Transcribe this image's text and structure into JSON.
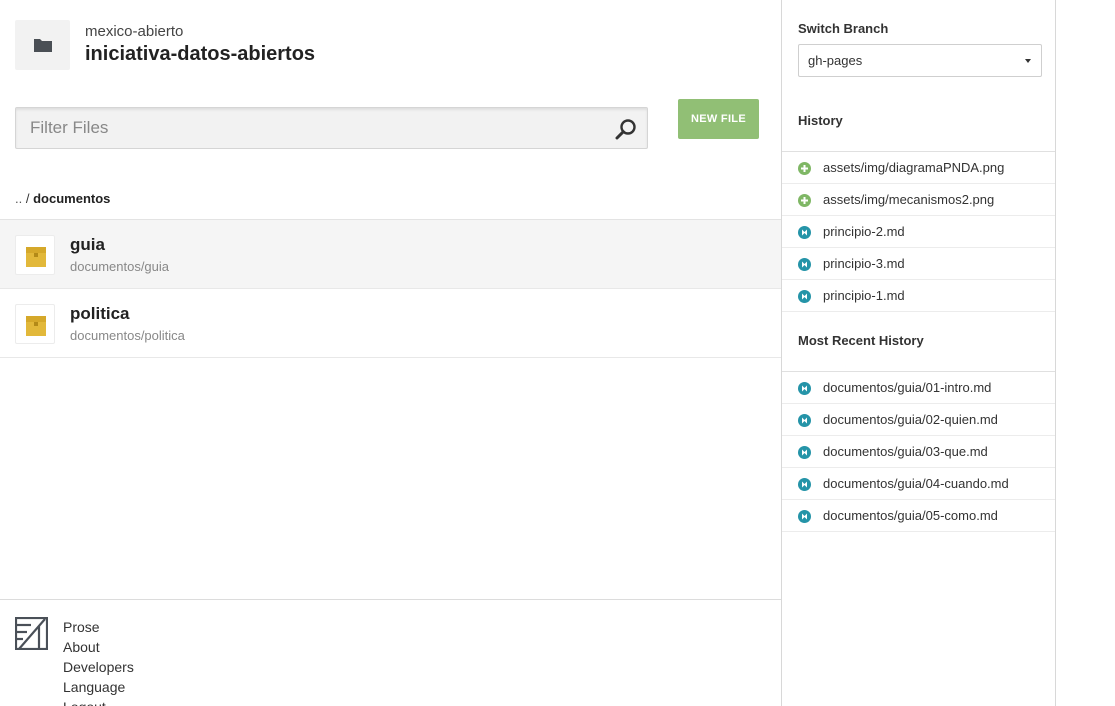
{
  "repo": {
    "owner": "mexico-abierto",
    "name": "iniciativa-datos-abiertos"
  },
  "filter": {
    "placeholder": "Filter Files",
    "value": ""
  },
  "toolbar": {
    "new_file_label": "NEW FILE"
  },
  "breadcrumb": {
    "up": "..",
    "separator": "/",
    "current": "documentos"
  },
  "files": [
    {
      "title": "guia",
      "path": "documentos/guia",
      "icon": "folder-icon"
    },
    {
      "title": "politica",
      "path": "documentos/politica",
      "icon": "folder-icon"
    }
  ],
  "footer": {
    "links": [
      "Prose",
      "About",
      "Developers",
      "Language",
      "Logout"
    ]
  },
  "sidebar": {
    "switch_branch_label": "Switch Branch",
    "branch": "gh-pages",
    "history_label": "History",
    "history": [
      {
        "status": "added",
        "file": "assets/img/diagramaPNDA.png"
      },
      {
        "status": "added",
        "file": "assets/img/mecanismos2.png"
      },
      {
        "status": "modified",
        "file": "principio-2.md"
      },
      {
        "status": "modified",
        "file": "principio-3.md"
      },
      {
        "status": "modified",
        "file": "principio-1.md"
      }
    ],
    "recent_label": "Most Recent History",
    "recent": [
      {
        "status": "modified",
        "file": "documentos/guia/01-intro.md"
      },
      {
        "status": "modified",
        "file": "documentos/guia/02-quien.md"
      },
      {
        "status": "modified",
        "file": "documentos/guia/03-que.md"
      },
      {
        "status": "modified",
        "file": "documentos/guia/04-cuando.md"
      },
      {
        "status": "modified",
        "file": "documentos/guia/05-como.md"
      }
    ]
  },
  "colors": {
    "new_file_button": "#91bf75",
    "added_status": "#7fb765",
    "modified_status": "#2594a8",
    "folder": "#e2b83a"
  }
}
